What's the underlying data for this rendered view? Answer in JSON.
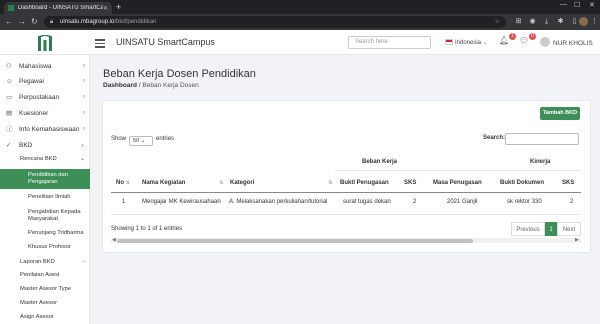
{
  "browser": {
    "tab_title": "Dashboard - UINSATU SmartCam",
    "url_host": "uinsatu.mbagroup.io",
    "url_path": "/bkd/pendidikan"
  },
  "header": {
    "app_title": "UINSATU SmartCampus",
    "search_placeholder": "Search here",
    "language": "Indonesia",
    "notif_count": "1",
    "chat_count": "0",
    "user_name": "NUR KHOLIS"
  },
  "sidebar": {
    "items": [
      {
        "icon": "users-icon",
        "label": "Mahasiswa"
      },
      {
        "icon": "user-icon",
        "label": "Pegawai"
      },
      {
        "icon": "book-icon",
        "label": "Perpustakaan"
      },
      {
        "icon": "clipboard-icon",
        "label": "Kuesioner"
      },
      {
        "icon": "info-icon",
        "label": "Info Kemahasiswaan"
      },
      {
        "icon": "check-icon",
        "label": "BKD"
      }
    ],
    "bkd_sub": {
      "rencana": "Rencana BKD",
      "children": [
        "Pendidikan dan Pengajaran",
        "Penelitian Ilmiah",
        "Pengabdian Kepada Masyarakat",
        "Penunjang Tridharma",
        "Khusus Profesor"
      ],
      "others": [
        "Laporan BKD",
        "Penilaian Asesi",
        "Master Asesor Type",
        "Master Asesor",
        "Asign Asesor"
      ]
    }
  },
  "page": {
    "title": "Beban Kerja Dosen Pendidikan",
    "breadcrumb_home": "Dashboard",
    "breadcrumb_sep": "/",
    "breadcrumb_current": "Beban Kerja Dosen"
  },
  "table_controls": {
    "add_button": "Tambah BKD",
    "show_label": "Show",
    "show_value": "50",
    "entries_label": "entries",
    "search_label": "Search:"
  },
  "table": {
    "group_headers": [
      "Beban Kerja",
      "Kinerja"
    ],
    "columns": [
      "No",
      "Nama Kegiatan",
      "Kategori",
      "Bukti Penugasan",
      "SKS",
      "Masa Penugasan",
      "Bukti Dokumen",
      "SKS"
    ],
    "rows": [
      [
        "1",
        "Mengajar MK Kewirausahaan",
        "A. Melaksanakan perkuliahan/tutorial",
        "surat tugas dekan",
        "2",
        "2021 Ganjil",
        "sk rektor 330",
        "2"
      ]
    ]
  },
  "footer": {
    "info": "Showing 1 to 1 of 1 entries",
    "prev": "Previous",
    "page": "1",
    "next": "Next"
  }
}
